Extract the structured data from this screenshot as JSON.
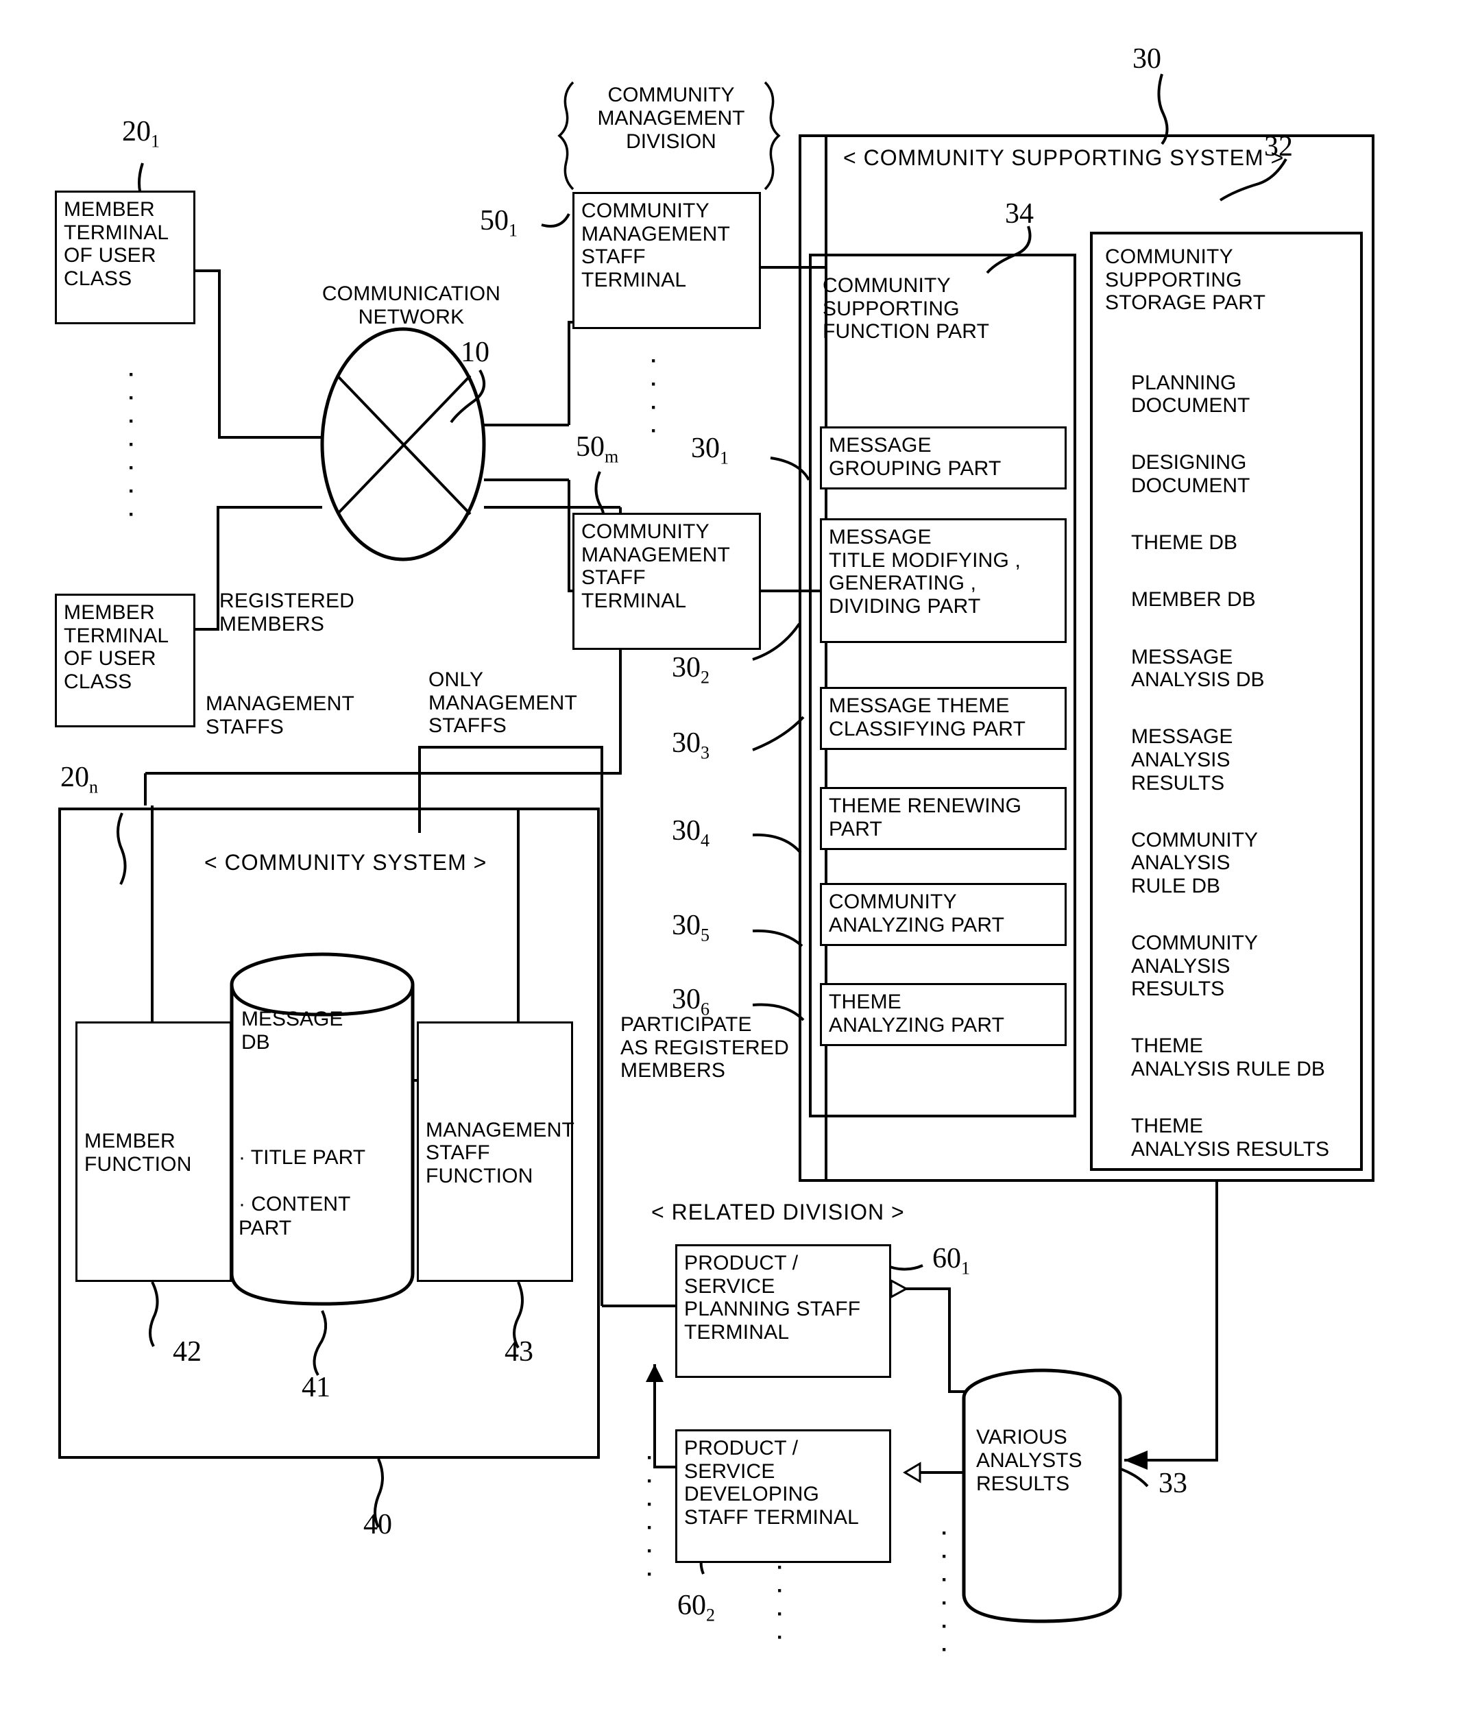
{
  "figure": {
    "title": "Community supporting system block diagram"
  },
  "terminals": {
    "member_terminal_1": "MEMBER\nTERMINAL\nOF USER\nCLASS",
    "member_terminal_1_ref": "20",
    "member_terminal_1_sub": "1",
    "member_terminal_n": "MEMBER\nTERMINAL\nOF USER\nCLASS",
    "member_terminal_n_ref": "20",
    "member_terminal_n_sub": "n"
  },
  "network": {
    "label": "COMMUNICATION\nNETWORK",
    "ref": "10"
  },
  "management_division": {
    "bracket_label": "COMMUNITY\nMANAGEMENT\nDIVISION",
    "staff_terminal_1": "COMMUNITY\nMANAGEMENT\nSTAFF\nTERMINAL",
    "staff_terminal_1_ref": "50",
    "staff_terminal_1_sub": "1",
    "staff_terminal_m": "COMMUNITY\nMANAGEMENT\nSTAFF\nTERMINAL",
    "staff_terminal_m_ref": "50",
    "staff_terminal_m_sub": "m"
  },
  "flow_labels": {
    "registered_members": "REGISTERED\nMEMBERS",
    "management_staffs": "MANAGEMENT\nSTAFFS",
    "only_management_staffs": "ONLY\nMANAGEMENT\nSTAFFS",
    "participate_as_registered_members": "PARTICIPATE\nAS REGISTERED\nMEMBERS"
  },
  "community_supporting_system": {
    "title": "< COMMUNITY SUPPORTING SYSTEM >",
    "ref": "30",
    "function_part": {
      "title": "COMMUNITY\nSUPPORTING\nFUNCTION PART",
      "ref": "34",
      "parts": [
        {
          "label": "MESSAGE\nGROUPING PART",
          "ref": "30",
          "sub": "1"
        },
        {
          "label": "MESSAGE\nTITLE MODIFYING ,\nGENERATING ,\nDIVIDING PART",
          "ref": "30",
          "sub": "2"
        },
        {
          "label": "MESSAGE THEME\nCLASSIFYING PART",
          "ref": "30",
          "sub": "3"
        },
        {
          "label": "THEME RENEWING\nPART",
          "ref": "30",
          "sub": "4"
        },
        {
          "label": "COMMUNITY\nANALYZING PART",
          "ref": "30",
          "sub": "5"
        },
        {
          "label": "THEME\nANALYZING PART",
          "ref": "30",
          "sub": "6"
        }
      ]
    },
    "storage_part": {
      "title": "COMMUNITY\nSUPPORTING\nSTORAGE PART",
      "ref": "32",
      "items": [
        "PLANNING\nDOCUMENT",
        "DESIGNING\nDOCUMENT",
        "THEME DB",
        "MEMBER DB",
        "MESSAGE\nANALYSIS DB",
        "MESSAGE\nANALYSIS\nRESULTS",
        "COMMUNITY\nANALYSIS\nRULE DB",
        "COMMUNITY\nANALYSIS\nRESULTS",
        "THEME\nANALYSIS RULE DB",
        "THEME\nANALYSIS RESULTS"
      ]
    }
  },
  "community_system": {
    "title": "< COMMUNITY SYSTEM >",
    "ref": "40",
    "message_db": {
      "label": "MESSAGE\nDB",
      "fields": "· TITLE PART\n\n· CONTENT\n  PART",
      "ref": "41"
    },
    "member_function": {
      "label": "MEMBER\nFUNCTION",
      "ref": "42"
    },
    "management_staff_function": {
      "label": "MANAGEMENT\nSTAFF\nFUNCTION",
      "ref": "43"
    }
  },
  "related_division": {
    "title": "< RELATED DIVISION >",
    "planning_terminal": "PRODUCT /\nSERVICE\nPLANNING STAFF\nTERMINAL",
    "planning_terminal_ref": "60",
    "planning_terminal_sub": "1",
    "developing_terminal": "PRODUCT /\nSERVICE\nDEVELOPING\nSTAFF TERMINAL",
    "developing_terminal_ref": "60",
    "developing_terminal_sub": "2",
    "analysts_results": {
      "label": "VARIOUS\nANALYSTS\nRESULTS",
      "ref": "33"
    }
  },
  "colors": {
    "line": "#000000",
    "background": "#ffffff"
  }
}
